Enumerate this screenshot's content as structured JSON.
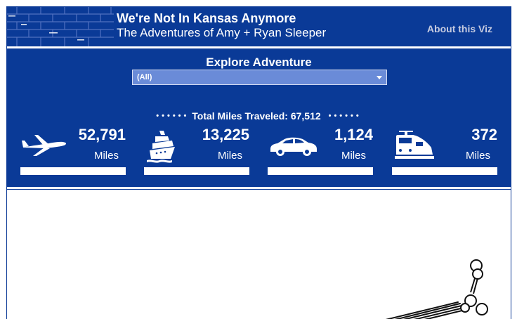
{
  "header": {
    "title": "We're Not In Kansas Anymore",
    "subtitle": "The Adventures of Amy + Ryan Sleeper",
    "about_link": "About this Viz"
  },
  "filter": {
    "label": "Explore Adventure",
    "selected": "(All)"
  },
  "total": {
    "text": "Total Miles Traveled: 67,512"
  },
  "stats": [
    {
      "icon": "airplane-icon",
      "value": "52,791",
      "unit": "Miles"
    },
    {
      "icon": "cruise-ship-icon",
      "value": "13,225",
      "unit": "Miles"
    },
    {
      "icon": "car-icon",
      "value": "1,124",
      "unit": "Miles"
    },
    {
      "icon": "train-icon",
      "value": "372",
      "unit": "Miles"
    }
  ],
  "colors": {
    "brand_blue": "#0a3a97",
    "dropdown": "#6a8bd8",
    "text": "#ffffff"
  }
}
